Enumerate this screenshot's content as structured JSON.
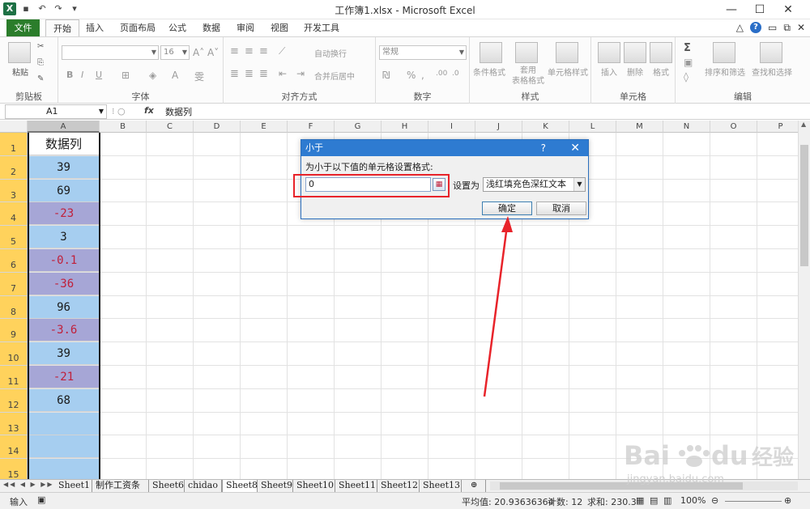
{
  "window": {
    "title": "工作簿1.xlsx - Microsoft Excel",
    "controls": [
      "—",
      "☐",
      "✕"
    ]
  },
  "ribbon": {
    "tabs": [
      "文件",
      "开始",
      "插入",
      "页面布局",
      "公式",
      "数据",
      "审阅",
      "视图",
      "开发工具"
    ],
    "groups": [
      "剪贴板",
      "字体",
      "对齐方式",
      "数字",
      "样式",
      "单元格",
      "编辑"
    ],
    "clipboard": {
      "paste": "粘贴"
    },
    "font": {
      "size": "16",
      "bold": "B",
      "italic": "I",
      "underline": "U"
    },
    "alignment": {
      "wrap": "自动换行",
      "merge": "合并后居中"
    },
    "number": {
      "format": "常规"
    },
    "styles": {
      "conditional": "条件格式",
      "table": "套用\n表格格式",
      "cell_styles": "单元格样式"
    },
    "cells": {
      "insert": "插入",
      "delete": "删除",
      "format": "格式"
    },
    "editing": {
      "sort": "排序和筛选",
      "find": "查找和选择"
    }
  },
  "formula_bar": {
    "name_box": "A1",
    "fx": "fx",
    "content": "数据列"
  },
  "grid": {
    "columns": [
      "A",
      "B",
      "C",
      "D",
      "E",
      "F",
      "G",
      "H",
      "I",
      "J",
      "K",
      "L",
      "M",
      "N",
      "O",
      "P"
    ],
    "rows": [
      "1",
      "2",
      "3",
      "4",
      "5",
      "6",
      "7",
      "8",
      "9",
      "10",
      "11",
      "12",
      "13",
      "14",
      "15"
    ],
    "column_a": [
      "数据列",
      "39",
      "69",
      "-23",
      "3",
      "-0.1",
      "-36",
      "96",
      "-3.6",
      "39",
      "-21",
      "68"
    ],
    "colors": {
      "positive_fill": "#a6cef0",
      "negative_fill": "#a6a6d6",
      "negative_text": "#c0203a"
    }
  },
  "dialog": {
    "title": "小于",
    "help": "?",
    "close": "✕",
    "prompt": "为小于以下值的单元格设置格式:",
    "input_value": "0",
    "set_label": "设置为",
    "format_option": "浅红填充色深红文本",
    "ok": "确定",
    "cancel": "取消"
  },
  "sheets": {
    "tabs": [
      "Sheet1",
      "制作工资条",
      "Sheet6",
      "chidao",
      "Sheet8",
      "Sheet9",
      "Sheet10",
      "Sheet11",
      "Sheet12",
      "Sheet13"
    ],
    "active": "Sheet8"
  },
  "status": {
    "mode": "输入",
    "average": "平均值: 20.93636364",
    "count": "计数: 12",
    "sum": "求和: 230.3",
    "zoom": "100%"
  },
  "watermark": {
    "brand": "Bai",
    "brand2": "du",
    "suffix": "经验",
    "url": "jingyan.baidu.com"
  }
}
